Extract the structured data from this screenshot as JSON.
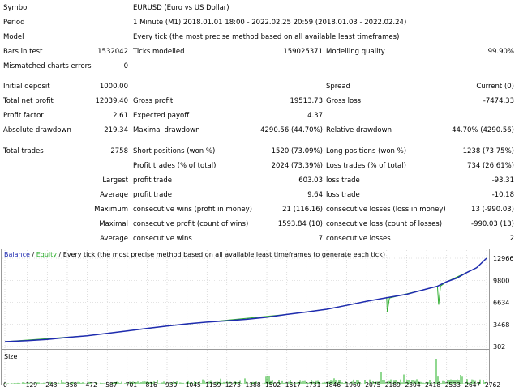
{
  "report": {
    "symbol_label": "Symbol",
    "symbol_value": "EURUSD (Euro vs US Dollar)",
    "period_label": "Period",
    "period_value": "1 Minute (M1) 2018.01.01 18:00 - 2022.02.25 20:59 (2018.01.03 - 2022.02.24)",
    "model_label": "Model",
    "model_value": "Every tick (the most precise method based on all available least timeframes)",
    "bars_label": "Bars in test",
    "bars_value": "1532042",
    "ticks_label": "Ticks modelled",
    "ticks_value": "159025371",
    "quality_label": "Modelling quality",
    "quality_value": "99.90%",
    "mismatched_label": "Mismatched charts errors",
    "mismatched_value": "0",
    "initial_deposit_label": "Initial deposit",
    "initial_deposit_value": "1000.00",
    "spread_label": "Spread",
    "spread_value": "Current (0)",
    "net_profit_label": "Total net profit",
    "net_profit_value": "12039.40",
    "gross_profit_label": "Gross profit",
    "gross_profit_value": "19513.73",
    "gross_loss_label": "Gross loss",
    "gross_loss_value": "-7474.33",
    "profit_factor_label": "Profit factor",
    "profit_factor_value": "2.61",
    "expected_payoff_label": "Expected payoff",
    "expected_payoff_value": "4.37",
    "abs_drawdown_label": "Absolute drawdown",
    "abs_drawdown_value": "219.34",
    "max_drawdown_label": "Maximal drawdown",
    "max_drawdown_value": "4290.56 (44.70%)",
    "rel_drawdown_label": "Relative drawdown",
    "rel_drawdown_value": "44.70% (4290.56)",
    "total_trades_label": "Total trades",
    "total_trades_value": "2758",
    "short_label": "Short positions (won %)",
    "short_value": "1520 (73.09%)",
    "long_label": "Long positions (won %)",
    "long_value": "1238 (73.75%)",
    "profit_trades_label": "Profit trades (% of total)",
    "profit_trades_value": "2024 (73.39%)",
    "loss_trades_label": "Loss trades (% of total)",
    "loss_trades_value": "734 (26.61%)",
    "largest_label": "Largest",
    "largest_profit_label": "profit trade",
    "largest_profit_value": "603.03",
    "largest_loss_label": "loss trade",
    "largest_loss_value": "-93.31",
    "average_label": "Average",
    "average_profit_label": "profit trade",
    "average_profit_value": "9.64",
    "average_loss_label": "loss trade",
    "average_loss_value": "-10.18",
    "maximum_label": "Maximum",
    "max_cons_wins_label": "consecutive wins (profit in money)",
    "max_cons_wins_value": "21 (116.16)",
    "max_cons_losses_label": "consecutive losses (loss in money)",
    "max_cons_losses_value": "13 (-990.03)",
    "maximal_label": "Maximal",
    "maximal_cons_profit_label": "consecutive profit (count of wins)",
    "maximal_cons_profit_value": "1593.84 (10)",
    "maximal_cons_loss_label": "consecutive loss (count of losses)",
    "maximal_cons_loss_value": "-990.03 (13)",
    "average2_label": "Average",
    "avg_cons_wins_label": "consecutive wins",
    "avg_cons_wins_value": "7",
    "avg_cons_losses_label": "consecutive losses",
    "avg_cons_losses_value": "2"
  },
  "chart_legend": {
    "balance": "Balance",
    "sep1": " / ",
    "equity": "Equity",
    "sep2": " / ",
    "rest": "Every tick (the most precise method based on all available least timeframes to generate each tick)",
    "size": "Size"
  },
  "colors": {
    "balance": "#1f2bb0",
    "equity": "#2fae2f",
    "size_bars": "#22b022",
    "grid": "#c8c8c8"
  },
  "chart_data": {
    "type": "line",
    "title": "",
    "xlabel": "",
    "ylabel": "",
    "y_ticks": [
      302,
      3468,
      6634,
      9800,
      12966
    ],
    "ylim": [
      302,
      12966
    ],
    "x_ticks": [
      0,
      129,
      243,
      358,
      472,
      587,
      701,
      816,
      930,
      1045,
      1159,
      1273,
      1388,
      1502,
      1617,
      1731,
      1846,
      1960,
      2075,
      2189,
      2304,
      2418,
      2533,
      2647,
      2762
    ],
    "xlim": [
      0,
      2762
    ],
    "grid": true,
    "legend": "top-left",
    "series": [
      {
        "name": "Balance",
        "x": [
          0,
          129,
          243,
          358,
          472,
          587,
          701,
          816,
          930,
          1045,
          1159,
          1273,
          1388,
          1502,
          1617,
          1731,
          1846,
          1960,
          2075,
          2189,
          2304,
          2418,
          2480,
          2533,
          2590,
          2647,
          2705,
          2762
        ],
        "y": [
          1000,
          1150,
          1330,
          1600,
          1850,
          2200,
          2550,
          2900,
          3230,
          3550,
          3800,
          4000,
          4200,
          4500,
          4900,
          5250,
          5650,
          6200,
          6800,
          7300,
          7800,
          8550,
          8950,
          9600,
          10100,
          10900,
          11600,
          12966
        ]
      },
      {
        "name": "Equity",
        "x": [
          0,
          472,
          930,
          1159,
          1617,
          1846,
          2075,
          2189,
          2193,
          2205,
          2418,
          2480,
          2487,
          2498,
          2533,
          2705,
          2762
        ],
        "y": [
          1000,
          1850,
          3230,
          3800,
          4900,
          5650,
          6800,
          7300,
          5200,
          7250,
          8550,
          8950,
          6300,
          8980,
          9600,
          11600,
          12966
        ]
      }
    ],
    "size_ticks": [
      0,
      129,
      243,
      358,
      472,
      587,
      701,
      816,
      930,
      1045,
      1159,
      1273,
      1388,
      1502,
      1617,
      1731,
      1846,
      1960,
      2075,
      2189,
      2304,
      2418,
      2533,
      2647,
      2762
    ]
  }
}
